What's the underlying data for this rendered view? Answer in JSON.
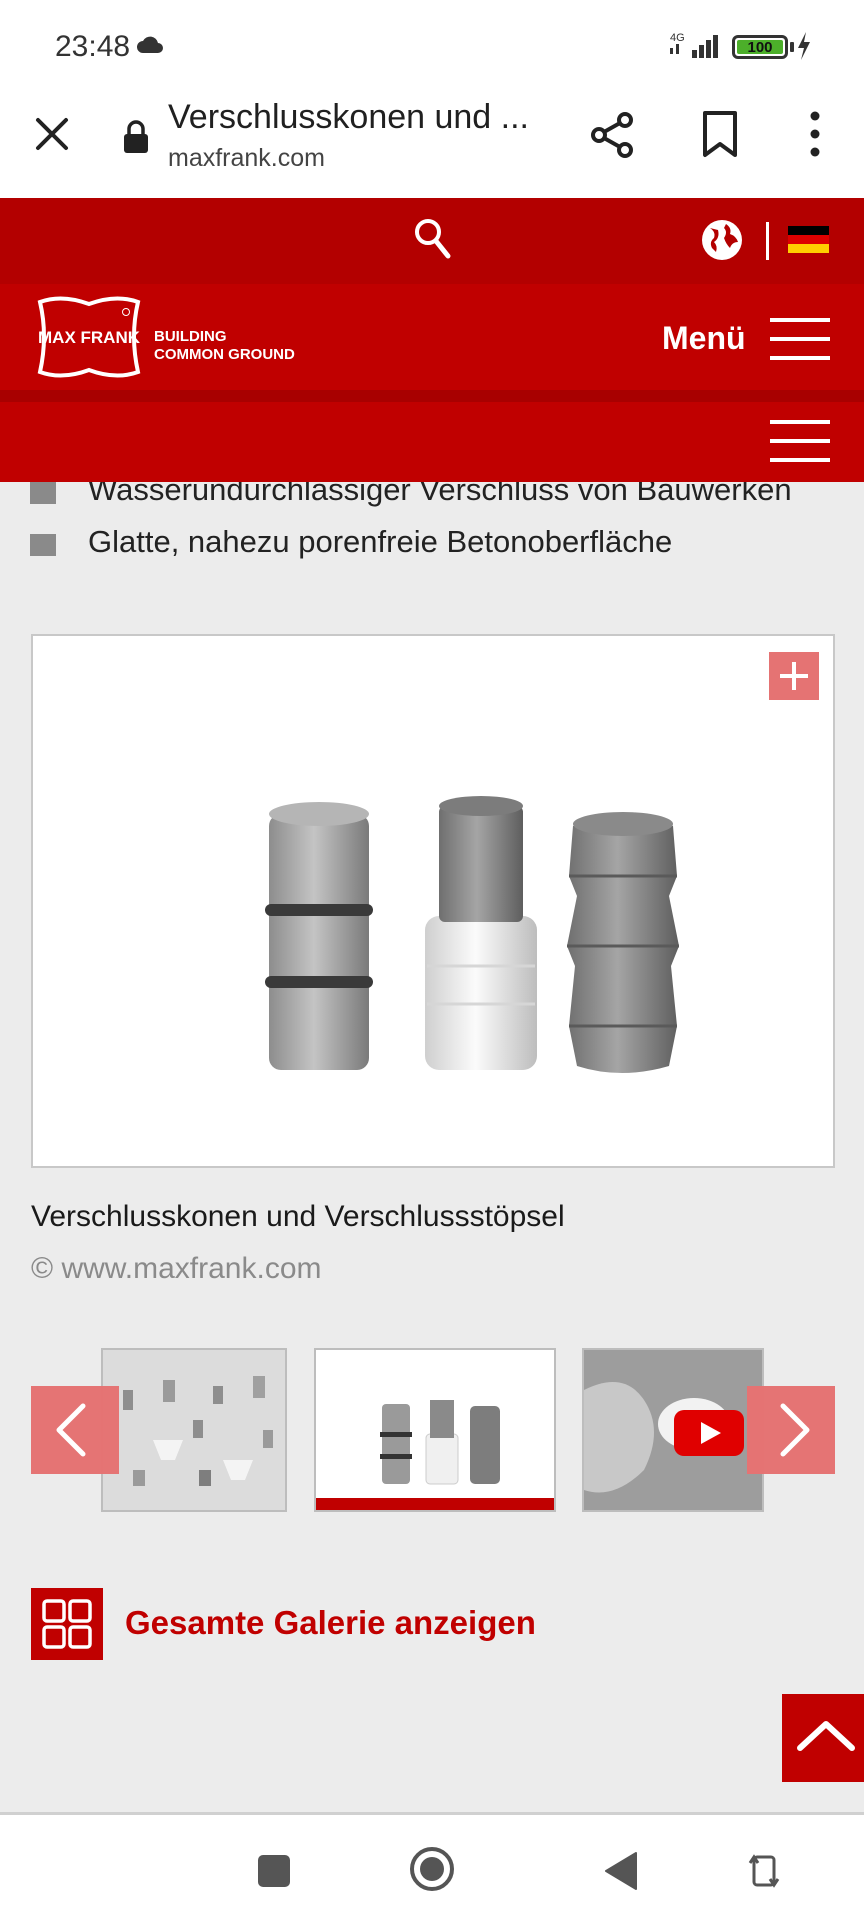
{
  "status_bar": {
    "time": "23:48",
    "network": "4G",
    "battery": "100"
  },
  "browser": {
    "page_title": "Verschlusskonen und ...",
    "domain": "maxfrank.com"
  },
  "site_header": {
    "logo_text": "MAX FRANK",
    "tagline_line1": "BUILDING",
    "tagline_line2": "COMMON GROUND",
    "menu_label": "Menü",
    "flag_colors": [
      "#000000",
      "#dd0000",
      "#ffce00"
    ]
  },
  "features": [
    "Wasserundurchlässiger Verschluss von Bauwerken",
    "Glatte, nahezu porenfreie Betonoberfläche"
  ],
  "gallery": {
    "caption": "Verschlusskonen und Verschlussstöpsel",
    "copyright": "© www.maxfrank.com",
    "thumbnails": [
      {
        "kind": "image",
        "active": false
      },
      {
        "kind": "image",
        "active": true
      },
      {
        "kind": "video",
        "active": false
      }
    ],
    "show_all_label": "Gesamte Galerie anzeigen"
  },
  "colors": {
    "brand_red": "#c00000",
    "brand_red_dark": "#b30000",
    "arrow_overlay": "#e57373"
  }
}
